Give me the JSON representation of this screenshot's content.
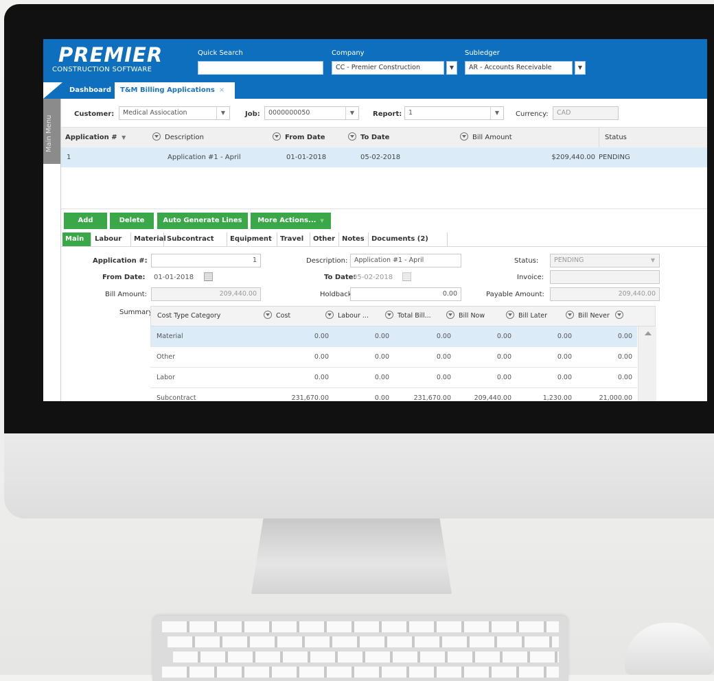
{
  "header": {
    "logo_main": "PREMIER",
    "logo_sub": "CONSTRUCTION SOFTWARE",
    "quick_search_label": "Quick Search",
    "quick_search_value": "",
    "company_label": "Company",
    "company_value": "CC - Premier Construction",
    "subledger_label": "Subledger",
    "subledger_value": "AR - Accounts Receivable",
    "caret": "▼"
  },
  "tabs": {
    "dashboard": "Dashboard",
    "active": "T&M Billing Applications",
    "close": "×"
  },
  "side_menu": "Main Menu",
  "filters": {
    "customer_label": "Customer:",
    "customer_value": "Medical Assiocation",
    "job_label": "Job:",
    "job_value": "0000000050",
    "report_label": "Report:",
    "report_value": "1",
    "currency_label": "Currency:",
    "currency_value": "CAD"
  },
  "grid": {
    "columns": [
      "Application #",
      "Description",
      "From Date",
      "To Date",
      "Bill Amount",
      "Status"
    ],
    "sort_indicator": "▼",
    "rows": [
      {
        "application": "1",
        "description": "Application #1 - April",
        "from_date": "01-01-2018",
        "to_date": "05-02-2018",
        "bill_amount": "$209,440.00",
        "status": "PENDING"
      }
    ]
  },
  "actions": {
    "add": "Add",
    "delete": "Delete",
    "auto_generate": "Auto Generate Lines",
    "more_actions": "More Actions...",
    "dropdown": "▼"
  },
  "subtabs": [
    "Main",
    "Labour",
    "Material",
    "Subcontract",
    "Equipment",
    "Travel",
    "Other",
    "Notes",
    "Documents (2)"
  ],
  "form": {
    "application_label": "Application #:",
    "application_value": "1",
    "description_label": "Description:",
    "description_value": "Application #1 - April",
    "status_label": "Status:",
    "status_value": "PENDING",
    "from_date_label": "From Date:",
    "from_date_value": "01-01-2018",
    "to_date_label": "To Date:",
    "to_date_value": "05-02-2018",
    "invoice_label": "Invoice:",
    "invoice_value": "",
    "bill_amount_label": "Bill Amount:",
    "bill_amount_value": "209,440.00",
    "holdback_label": "Holdback:",
    "holdback_value": "0.00",
    "payable_label": "Payable Amount:",
    "payable_value": "209,440.00",
    "summary_label": "Summary:"
  },
  "summary": {
    "columns": [
      "Cost Type Category",
      "Cost",
      "Labour ...",
      "Total Bill...",
      "Bill Now",
      "Bill Later",
      "Bill Never"
    ],
    "rows": [
      {
        "category": "Material",
        "cost": "0.00",
        "labour": "0.00",
        "total_bill": "0.00",
        "bill_now": "0.00",
        "bill_later": "0.00",
        "bill_never": "0.00"
      },
      {
        "category": "Other",
        "cost": "0.00",
        "labour": "0.00",
        "total_bill": "0.00",
        "bill_now": "0.00",
        "bill_later": "0.00",
        "bill_never": "0.00"
      },
      {
        "category": "Labor",
        "cost": "0.00",
        "labour": "0.00",
        "total_bill": "0.00",
        "bill_now": "0.00",
        "bill_later": "0.00",
        "bill_never": "0.00"
      },
      {
        "category": "Subcontract",
        "cost": "231,670.00",
        "labour": "0.00",
        "total_bill": "231,670.00",
        "bill_now": "209,440.00",
        "bill_later": "1,230.00",
        "bill_never": "21,000.00"
      }
    ]
  },
  "colors": {
    "brand_blue": "#0d6fbe",
    "action_green": "#3aa848",
    "selected_row": "#dcebf8"
  },
  "icons": {
    "filter": "filter-icon",
    "calendar": "calendar-icon",
    "scroll_up": "scroll-up-icon"
  }
}
